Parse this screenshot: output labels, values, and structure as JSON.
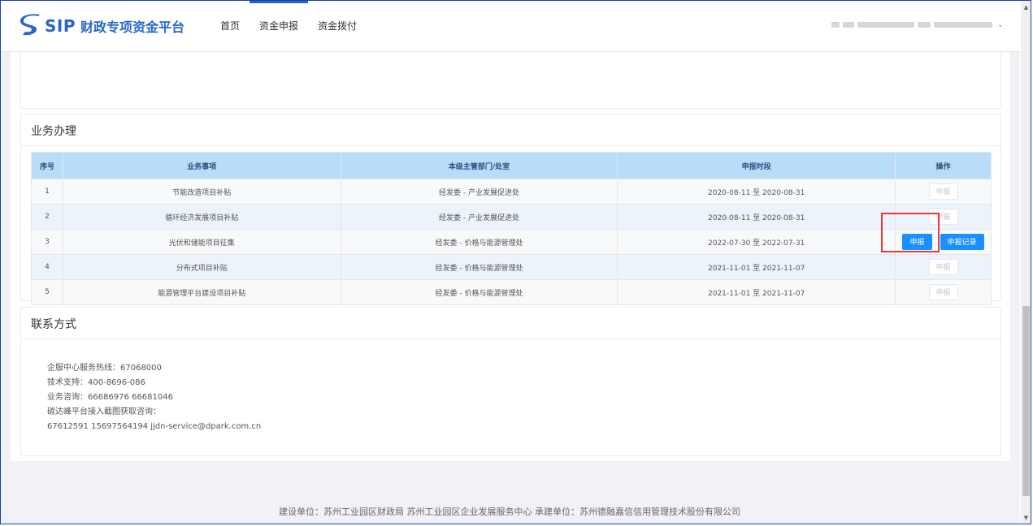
{
  "brand": {
    "sip": "SIP",
    "title": "财政专项资金平台",
    "color": "#2a66c9"
  },
  "nav": [
    {
      "label": "首页",
      "active": false
    },
    {
      "label": "资金申报",
      "active": true
    },
    {
      "label": "资金拨付",
      "active": false
    }
  ],
  "business": {
    "title": "业务办理",
    "columns": [
      "序号",
      "业务事项",
      "本级主管部门/处室",
      "申报时段",
      "操作"
    ],
    "rows": [
      {
        "no": "1",
        "item": "节能改造项目补贴",
        "dept": "经发委 - 产业发展促进处",
        "period": "2020-08-11 至 2020-08-31",
        "apply": "申报",
        "apply_enabled": false,
        "record": ""
      },
      {
        "no": "2",
        "item": "循环经济发展项目补贴",
        "dept": "经发委 - 产业发展促进处",
        "period": "2020-08-11 至 2020-08-31",
        "apply": "申报",
        "apply_enabled": false,
        "record": ""
      },
      {
        "no": "3",
        "item": "光伏和储能项目征集",
        "dept": "经发委 - 价格与能源管理处",
        "period": "2022-07-30 至 2022-07-31",
        "apply": "申报",
        "apply_enabled": true,
        "record": "申报记录"
      },
      {
        "no": "4",
        "item": "分布式项目补贴",
        "dept": "经发委 - 价格与能源管理处",
        "period": "2021-11-01 至 2021-11-07",
        "apply": "申报",
        "apply_enabled": false,
        "record": ""
      },
      {
        "no": "5",
        "item": "能源管理平台建设项目补贴",
        "dept": "经发委 - 价格与能源管理处",
        "period": "2021-11-01 至 2021-11-07",
        "apply": "申报",
        "apply_enabled": false,
        "record": ""
      }
    ]
  },
  "contact": {
    "title": "联系方式",
    "lines": [
      "企服中心服务热线：67068000",
      "技术支持：400-8696-086",
      "业务咨询：66686976 66681046",
      "碳达峰平台接入截图获取咨询：",
      "67612591 15697564194 jjdn-service@dpark.com.cn"
    ]
  },
  "footer": "建设单位：苏州工业园区财政局 苏州工业园区企业发展服务中心 承建单位：苏州德融嘉信信用管理技术股份有限公司",
  "colors": {
    "accent": "#1890ff",
    "table_header": "#b9dcf8",
    "highlight": "#e83a3a"
  }
}
